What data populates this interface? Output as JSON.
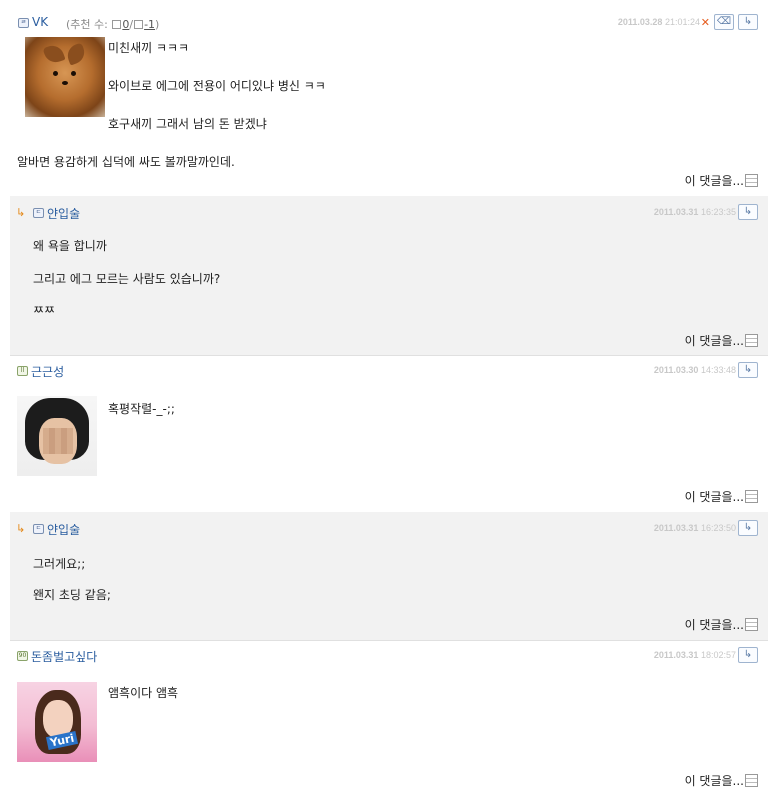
{
  "comments": [
    {
      "name": "VK",
      "level_icon": "level-badge-icon",
      "recommend": {
        "label": "(추천 수:",
        "up": "0",
        "sep": "/",
        "down": "-1",
        "close": ")"
      },
      "date": "2011.03.28",
      "time": "21:01:24",
      "lines": [
        "미친새끼 ㅋㅋㅋ",
        "와이브로 에그에 전용이 어디있냐 병신 ㅋㅋ",
        "호구새끼 그래서 남의 돈 받겠냐",
        "알바면 용감하게 십덕에 싸도 볼까말까인데."
      ],
      "more": "이 댓글을..."
    },
    {
      "name": "얀입술",
      "date": "2011.03.31",
      "time": "16:23:35",
      "lines": [
        "왜 욕을 합니까",
        "그리고 에그 모르는 사람도 있습니까?",
        "ㅉㅉ"
      ],
      "more": "이 댓글을..."
    },
    {
      "name": "근근성",
      "date": "2011.03.30",
      "time": "14:33:48",
      "lines": [
        "혹평작렬-_-;;"
      ],
      "more": "이 댓글을..."
    },
    {
      "name": "얀입술",
      "date": "2011.03.31",
      "time": "16:23:50",
      "lines": [
        "그러게요;;",
        "왠지 초딩 같음;"
      ],
      "more": "이 댓글을..."
    },
    {
      "name": "돈좀벌고싶다",
      "date": "2011.03.31",
      "time": "18:02:57",
      "lines": [
        "앰흑이다 앰흑"
      ],
      "avatar_tag": "Yuri",
      "more": "이 댓글을..."
    }
  ],
  "icons": {
    "reply_arrow": "↳",
    "delete": "✕",
    "edit_icon": "eraser-icon",
    "reply_icon": "reply-icon"
  },
  "colors": {
    "name": "#2a5d9f",
    "reply_bg": "#f2f2f2",
    "date": "#c8c8c8",
    "delete": "#e55b1d"
  }
}
